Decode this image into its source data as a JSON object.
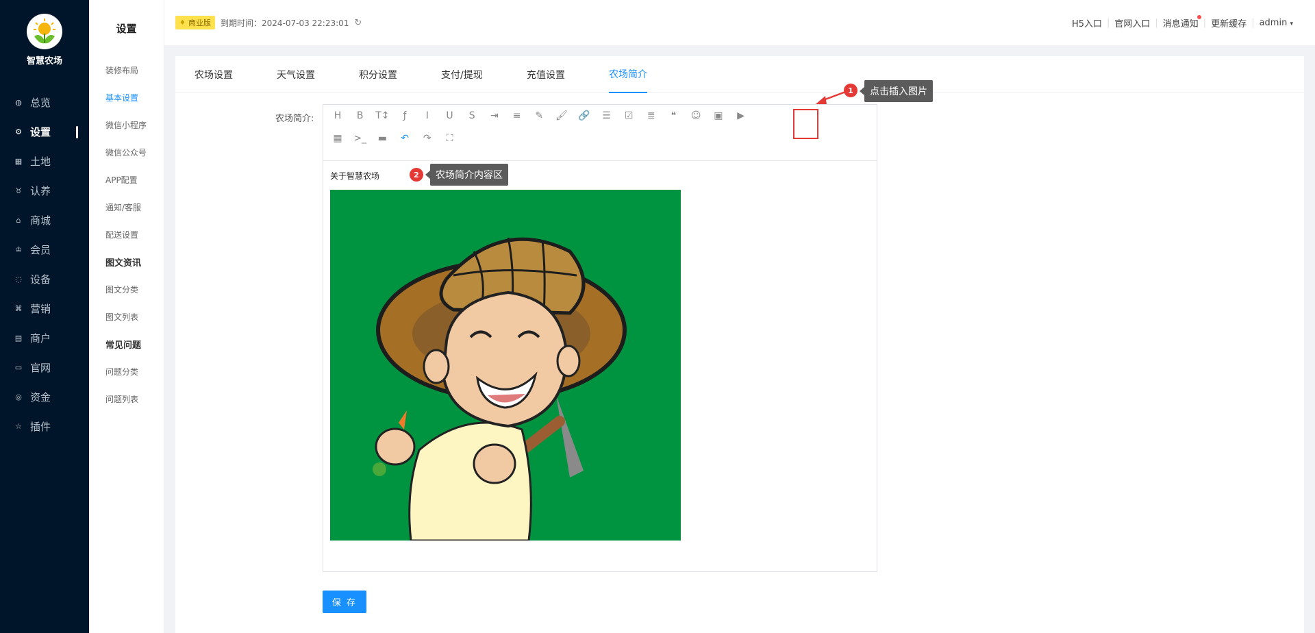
{
  "brand": {
    "name": "智慧农场"
  },
  "sidebar": {
    "items": [
      {
        "label": "总览",
        "icon": "dashboard-icon",
        "glyph": "◍"
      },
      {
        "label": "设置",
        "icon": "gear-icon",
        "glyph": "⚙"
      },
      {
        "label": "土地",
        "icon": "grid-icon",
        "glyph": "▦"
      },
      {
        "label": "认养",
        "icon": "adopt-icon",
        "glyph": "♉"
      },
      {
        "label": "商城",
        "icon": "shop-icon",
        "glyph": "⌂"
      },
      {
        "label": "会员",
        "icon": "member-icon",
        "glyph": "♔"
      },
      {
        "label": "设备",
        "icon": "device-icon",
        "glyph": "◌"
      },
      {
        "label": "营销",
        "icon": "marketing-icon",
        "glyph": "⌘"
      },
      {
        "label": "商户",
        "icon": "merchant-icon",
        "glyph": "▤"
      },
      {
        "label": "官网",
        "icon": "website-icon",
        "glyph": "▭"
      },
      {
        "label": "资金",
        "icon": "funds-icon",
        "glyph": "◎"
      },
      {
        "label": "插件",
        "icon": "plugin-icon",
        "glyph": "☆"
      }
    ],
    "active_index": 1
  },
  "subside": {
    "title": "设置",
    "items": [
      {
        "label": "装修布局",
        "type": "item"
      },
      {
        "label": "基本设置",
        "type": "active"
      },
      {
        "label": "微信小程序",
        "type": "item"
      },
      {
        "label": "微信公众号",
        "type": "item"
      },
      {
        "label": "APP配置",
        "type": "item"
      },
      {
        "label": "通知/客服",
        "type": "item"
      },
      {
        "label": "配送设置",
        "type": "item"
      },
      {
        "label": "图文资讯",
        "type": "group"
      },
      {
        "label": "图文分类",
        "type": "item"
      },
      {
        "label": "图文列表",
        "type": "item"
      },
      {
        "label": "常见问题",
        "type": "group"
      },
      {
        "label": "问题分类",
        "type": "item"
      },
      {
        "label": "问题列表",
        "type": "item"
      }
    ]
  },
  "header": {
    "edition_badge": "商业版",
    "expire_label": "到期时间：2024-07-03 22:23:01",
    "links": [
      "H5入口",
      "官网入口",
      "消息通知",
      "更新缓存"
    ],
    "user": "admin"
  },
  "tabs": [
    "农场设置",
    "天气设置",
    "积分设置",
    "支付/提现",
    "充值设置",
    "农场简介"
  ],
  "active_tab": 5,
  "form": {
    "field_label": "农场简介:",
    "content_text": "关于智慧农场",
    "save_label": "保 存"
  },
  "toolbar": {
    "row1": [
      {
        "icon": "heading-icon",
        "glyph": "H"
      },
      {
        "icon": "bold-icon",
        "glyph": "B"
      },
      {
        "icon": "font-size-icon",
        "glyph": "T↕"
      },
      {
        "icon": "font-family-icon",
        "glyph": "ƒ"
      },
      {
        "icon": "italic-icon",
        "glyph": "I"
      },
      {
        "icon": "underline-icon",
        "glyph": "U"
      },
      {
        "icon": "strikethrough-icon",
        "glyph": "S"
      },
      {
        "icon": "indent-icon",
        "glyph": "⇥"
      },
      {
        "icon": "line-height-icon",
        "glyph": "≡"
      },
      {
        "icon": "text-color-icon",
        "glyph": "✎"
      },
      {
        "icon": "bg-color-icon",
        "glyph": "🖌"
      },
      {
        "icon": "link-icon",
        "glyph": "🔗"
      },
      {
        "icon": "list-icon",
        "glyph": "☰"
      },
      {
        "icon": "todo-icon",
        "glyph": "☑"
      },
      {
        "icon": "justify-icon",
        "glyph": "≣"
      },
      {
        "icon": "quote-icon",
        "glyph": "❝"
      },
      {
        "icon": "emoji-icon",
        "glyph": "☺"
      },
      {
        "icon": "image-icon",
        "glyph": "▣"
      },
      {
        "icon": "video-icon",
        "glyph": "▶"
      }
    ],
    "row2": [
      {
        "icon": "table-icon",
        "glyph": "▦"
      },
      {
        "icon": "code-icon",
        "glyph": ">_"
      },
      {
        "icon": "divider-icon",
        "glyph": "▬"
      },
      {
        "icon": "undo-icon",
        "glyph": "↶"
      },
      {
        "icon": "redo-icon",
        "glyph": "↷"
      },
      {
        "icon": "fullscreen-icon",
        "glyph": "⛶"
      }
    ]
  },
  "annotations": [
    {
      "number": "1",
      "text": "点击插入图片"
    },
    {
      "number": "2",
      "text": "农场简介内容区"
    }
  ],
  "colors": {
    "sidebar_bg": "#001529",
    "primary": "#1890ff",
    "picture_bg": "#009440",
    "annotation_red": "#e53935"
  }
}
